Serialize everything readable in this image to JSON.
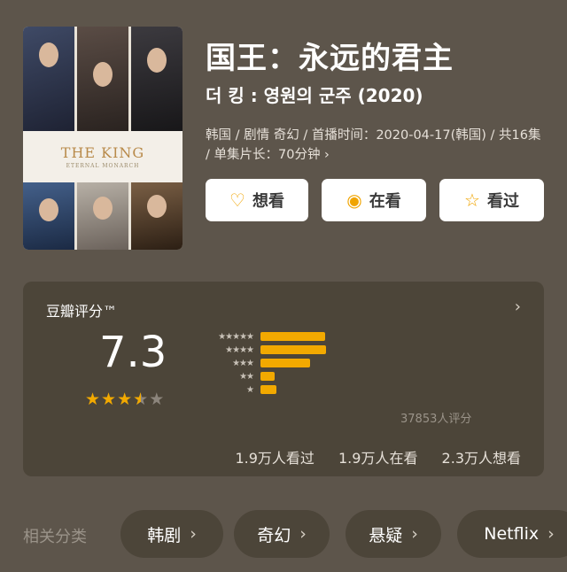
{
  "poster": {
    "title": "THE KING",
    "subtitle": "ETERNAL MONARCH"
  },
  "title": "国王：永远的君主",
  "subtitle": "더 킹 : 영원의 군주 (2020)",
  "meta": "韩国 / 剧情 奇幻 / 首播时间：2020-04-17(韩国) / 共16集 / 单集片长：70分钟 ›",
  "actions": [
    {
      "label": "想看",
      "icon": "heart-plus-icon",
      "glyph": "♡"
    },
    {
      "label": "在看",
      "icon": "target-icon",
      "glyph": "◉"
    },
    {
      "label": "看过",
      "icon": "star-outline-icon",
      "glyph": "☆"
    }
  ],
  "rating": {
    "label": "豆瓣评分™",
    "chevron": "›",
    "score": "7.3",
    "stars_value": 3.5,
    "distribution": [
      {
        "stars": "★★★★★",
        "fraction": 0.98
      },
      {
        "stars": "★★★★",
        "fraction": 1.0
      },
      {
        "stars": "★★★",
        "fraction": 0.76
      },
      {
        "stars": "★★",
        "fraction": 0.22
      },
      {
        "stars": "★",
        "fraction": 0.24
      }
    ],
    "count": "37853人评分",
    "stats": [
      "1.9万人看过",
      "1.9万人在看",
      "2.3万人想看"
    ]
  },
  "categories": {
    "label": "相关分类",
    "items": [
      "韩剧",
      "奇幻",
      "悬疑",
      "Netflix"
    ]
  },
  "colors": {
    "accent": "#f2a900",
    "background": "#5d554b",
    "card": "#4c4539"
  }
}
